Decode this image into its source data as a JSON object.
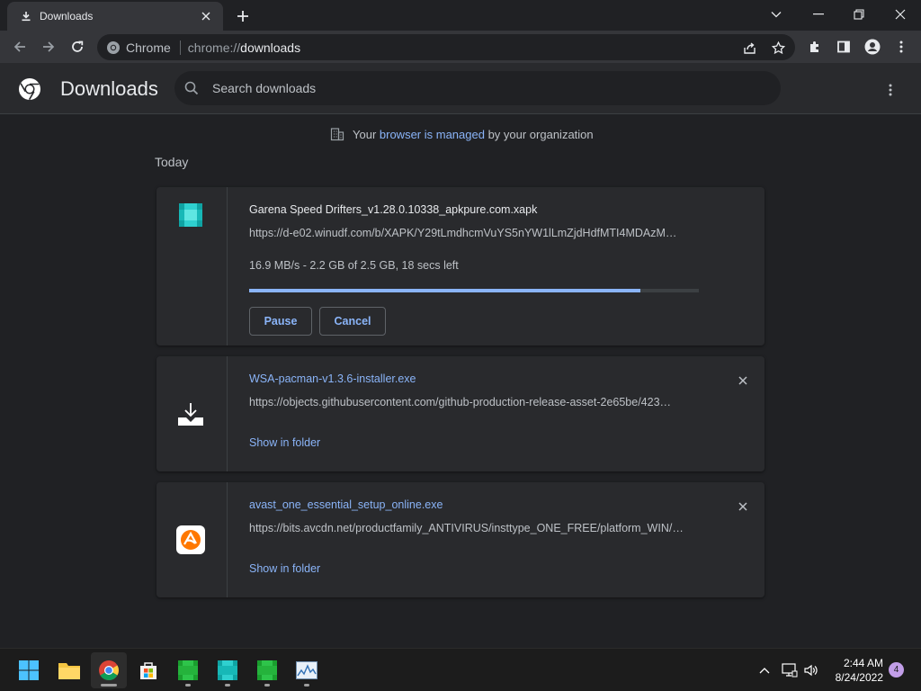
{
  "browser": {
    "tab_title": "Downloads",
    "site_label": "Chrome",
    "url_scheme": "chrome://",
    "url_path": "downloads"
  },
  "header": {
    "title": "Downloads",
    "search_placeholder": "Search downloads"
  },
  "managed_notice": {
    "before": "Your ",
    "link": "browser is managed",
    "after": " by your organization"
  },
  "section_label": "Today",
  "downloads": [
    {
      "icon": "teal-cube-icon",
      "name": "Garena Speed Drifters_v1.28.0.10338_apkpure.com.xapk",
      "url": "https://d-e02.winudf.com/b/XAPK/Y29tLmdhcmVuYS5nYW1lLmZjdHdfMTI4MDAzM…",
      "status": "16.9 MB/s - 2.2 GB of 2.5 GB, 18 secs left",
      "progress": 0.87,
      "pause_label": "Pause",
      "cancel_label": "Cancel"
    },
    {
      "icon": "download-tray-icon",
      "name": "WSA-pacman-v1.3.6-installer.exe",
      "url": "https://objects.githubusercontent.com/github-production-release-asset-2e65be/423…",
      "action_label": "Show in folder"
    },
    {
      "icon": "avast-icon",
      "name": "avast_one_essential_setup_online.exe",
      "url": "https://bits.avcdn.net/productfamily_ANTIVIRUS/insttype_ONE_FREE/platform_WIN/…",
      "action_label": "Show in folder"
    }
  ],
  "taskbar": {
    "time": "2:44 AM",
    "date": "8/24/2022",
    "notifications": "4"
  },
  "colors": {
    "accent": "#8ab4f8",
    "background": "#202124",
    "card": "#292a2d"
  }
}
